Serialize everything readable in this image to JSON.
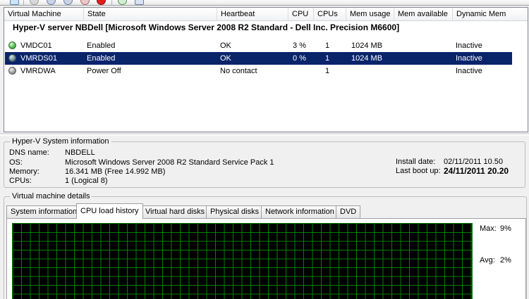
{
  "columns": [
    "Virtual Machine",
    "State",
    "Heartbeat",
    "CPU",
    "CPUs",
    "Mem usage",
    "Mem available",
    "Dynamic Mem"
  ],
  "server_group": "Hyper-V server NBDell [Microsoft Windows Server 2008 R2 Standard - Dell Inc. Precision M6600]",
  "vms": [
    {
      "name": "VMDC01",
      "status": "running",
      "state": "Enabled",
      "heartbeat": "OK",
      "cpu": "3 %",
      "cpus": "1",
      "mem_usage": "1024 MB",
      "mem_available": "",
      "dynamic_mem": "Inactive"
    },
    {
      "name": "VMRDS01",
      "status": "running",
      "state": "Enabled",
      "heartbeat": "OK",
      "cpu": "0 %",
      "cpus": "1",
      "mem_usage": "1024 MB",
      "mem_available": "",
      "dynamic_mem": "Inactive"
    },
    {
      "name": "VMRDWA",
      "status": "off",
      "state": "Power Off",
      "heartbeat": "No contact",
      "cpu": "",
      "cpus": "1",
      "mem_usage": "",
      "mem_available": "",
      "dynamic_mem": "Inactive"
    }
  ],
  "sysinfo": {
    "title": "Hyper-V System information",
    "dns_label": "DNS name:",
    "dns_value": "NBDELL",
    "os_label": "OS:",
    "os_value": "Microsoft Windows Server 2008 R2 Standard  Service Pack 1",
    "memory_label": "Memory:",
    "memory_value": "16.341 MB (Free 14.992 MB)",
    "cpus_label": "CPUs:",
    "cpus_value": "1 (Logical 8)",
    "install_label": "Install date:",
    "install_value": "02/11/2011 10.50",
    "boot_label": "Last boot up:",
    "boot_value": "24/11/2011 20.20"
  },
  "details": {
    "title": "Virtual machine details",
    "tabs": [
      "System information",
      "CPU load history",
      "Virtual hard disks",
      "Physical disks",
      "Network information",
      "DVD"
    ],
    "active_tab": "CPU load history",
    "max_label": "Max:",
    "max_value": "9%",
    "avg_label": "Avg:",
    "avg_value": "2%"
  },
  "colors": {
    "selection": "#0a246a",
    "graph_bg": "#000000",
    "graph_grid": "#008000"
  },
  "icons": [
    "view-icon",
    "start-icon",
    "pause-icon",
    "save-icon",
    "shutdown-icon",
    "stop-icon",
    "refresh-icon",
    "settings-icon"
  ]
}
